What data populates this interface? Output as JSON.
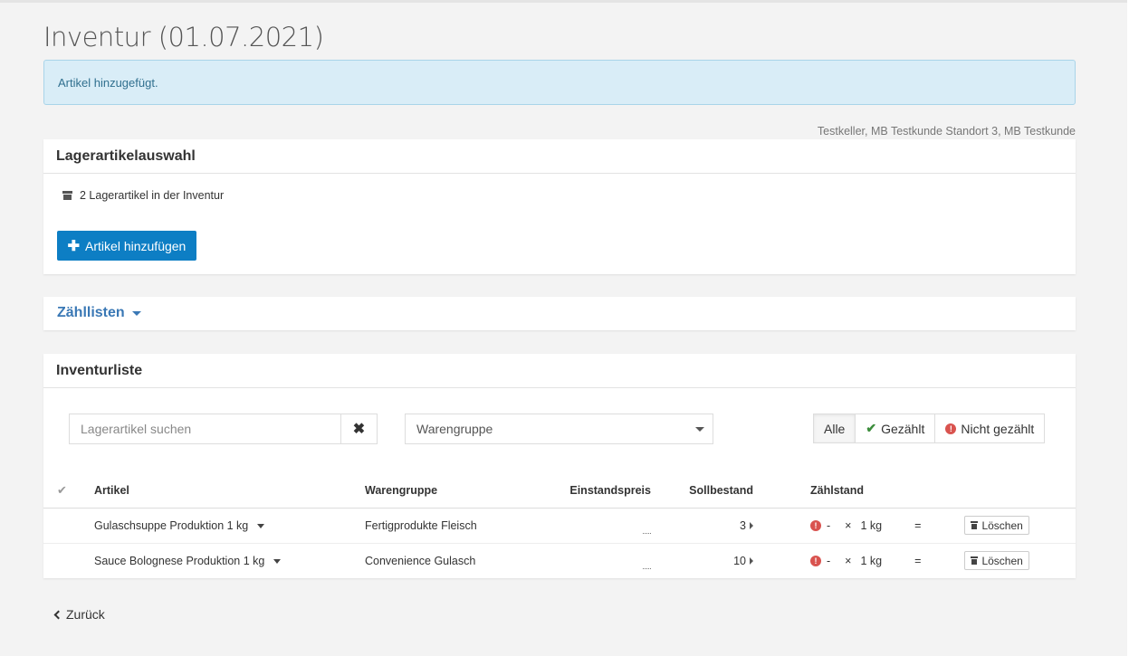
{
  "page": {
    "title": "Inventur (01.07.2021)",
    "alert": "Artikel hinzugefügt.",
    "location": "Testkeller, MB Testkunde Standort 3, MB Testkunde"
  },
  "selection_panel": {
    "title": "Lagerartikelauswahl",
    "stock_count_text": "2 Lagerartikel in der Inventur",
    "add_button_label": "Artikel hinzufügen",
    "stock_icon": "archive-box-icon",
    "add_icon": "plus-icon"
  },
  "count_lists_panel": {
    "title": "Zähllisten"
  },
  "inventory_panel": {
    "title": "Inventurliste",
    "search_placeholder": "Lagerartikel suchen",
    "search_value": "",
    "group_select_value": "Warengruppe",
    "filters": [
      "Alle",
      "Gezählt",
      "Nicht gezählt"
    ],
    "active_filter": "Alle",
    "columns": [
      "",
      "Artikel",
      "Warengruppe",
      "Einstandspreis",
      "Sollbestand",
      "Zählstand"
    ],
    "rows": [
      {
        "article": "Gulaschsuppe Produktion 1 kg",
        "group": "Fertigprodukte Fleisch",
        "price": "...",
        "target": "3",
        "count_value": "-",
        "multiplier": "×",
        "unit": "1 kg",
        "equals": "=",
        "delete_label": "Löschen"
      },
      {
        "article": "Sauce Bolognese Produktion 1 kg",
        "group": "Convenience Gulasch",
        "price": "...",
        "target": "10",
        "count_value": "-",
        "multiplier": "×",
        "unit": "1 kg",
        "equals": "=",
        "delete_label": "Löschen"
      }
    ]
  },
  "back_link_label": "Zurück",
  "colors": {
    "primary": "#0d7ec4",
    "link": "#3a78b5",
    "alert_bg": "#d9edf7",
    "alert_text": "#31708f",
    "danger": "#d9534f",
    "success": "#3c8d3c"
  }
}
